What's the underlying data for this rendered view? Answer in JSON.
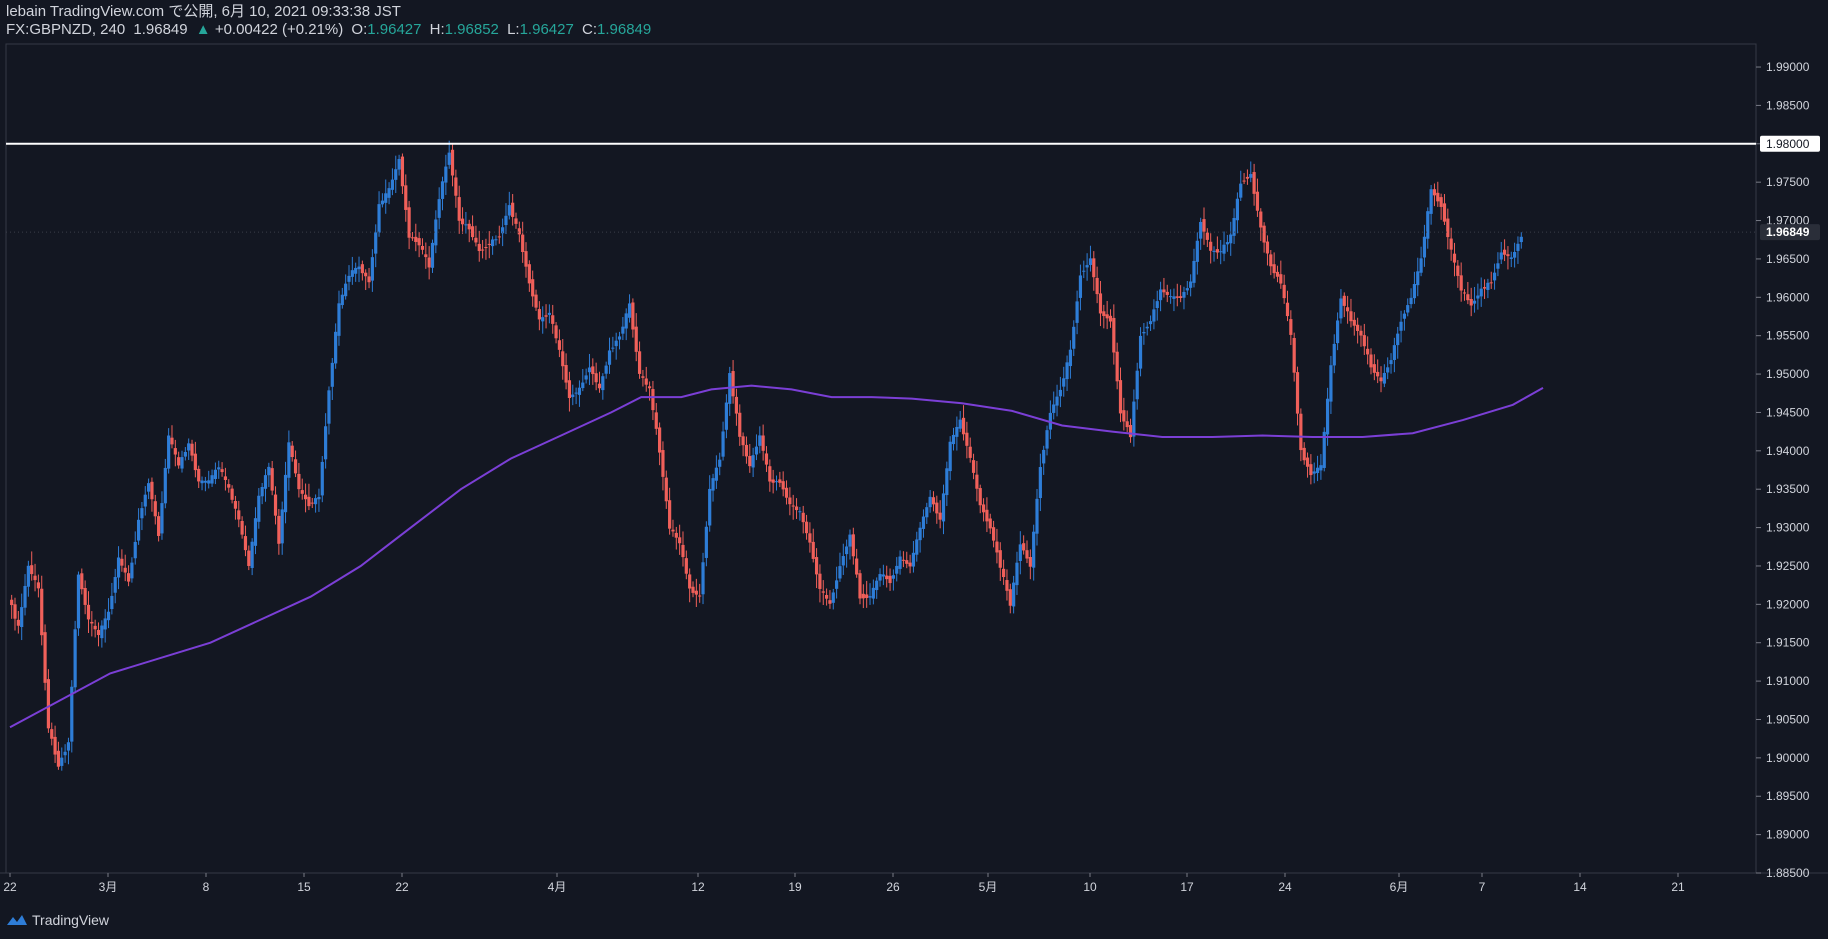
{
  "header": {
    "published": "lebain TradingView.com で公開, 6月 10, 2021 09:33:38 JST",
    "symbol": "FX:GBPNZD, 240",
    "last": "1.96849",
    "change_arrow": "▲",
    "change": "+0.00422 (+0.21%)",
    "o_label": "O:",
    "o_value": "1.96427",
    "h_label": "H:",
    "h_value": "1.96852",
    "l_label": "L:",
    "l_value": "1.96427",
    "c_label": "C:",
    "c_value": "1.96849"
  },
  "footer": {
    "brand": "TradingView"
  },
  "colors": {
    "background": "#131722",
    "up": "#2e7dd7",
    "down": "#f0605a",
    "ma": "#7b3fd6",
    "hline": "#ffffff",
    "grid": "#2a2e39"
  },
  "chart_data": {
    "type": "candlestick",
    "symbol": "FX:GBPNZD",
    "interval": "240",
    "y_axis": {
      "ylim": [
        1.885,
        1.993
      ],
      "ticks": [
        "1.99000",
        "1.98500",
        "1.98000",
        "1.97500",
        "1.97000",
        "1.96500",
        "1.96000",
        "1.95500",
        "1.95000",
        "1.94500",
        "1.94000",
        "1.93500",
        "1.93000",
        "1.92500",
        "1.92000",
        "1.91500",
        "1.91000",
        "1.90500",
        "1.90000",
        "1.89500",
        "1.89000",
        "1.88500"
      ]
    },
    "x_axis": {
      "labels": [
        "22",
        "3月",
        "8",
        "15",
        "22",
        "4月",
        "12",
        "19",
        "26",
        "5月",
        "10",
        "17",
        "24",
        "6月",
        "7",
        "14",
        "21"
      ]
    },
    "horizontal_line": {
      "value": 1.98,
      "label": "1.98000"
    },
    "last_price_label": "1.96849",
    "price_path": [
      [
        0,
        1.921
      ],
      [
        1,
        1.917
      ],
      [
        2,
        1.925
      ],
      [
        3,
        1.922
      ],
      [
        4,
        1.904
      ],
      [
        5,
        1.899
      ],
      [
        6,
        1.902
      ],
      [
        7,
        1.924
      ],
      [
        8,
        1.918
      ],
      [
        9,
        1.916
      ],
      [
        10,
        1.919
      ],
      [
        11,
        1.926
      ],
      [
        12,
        1.923
      ],
      [
        13,
        1.931
      ],
      [
        14,
        1.936
      ],
      [
        15,
        1.929
      ],
      [
        16,
        1.942
      ],
      [
        17,
        1.938
      ],
      [
        18,
        1.941
      ],
      [
        19,
        1.936
      ],
      [
        20,
        1.936
      ],
      [
        21,
        1.938
      ],
      [
        22,
        1.935
      ],
      [
        23,
        1.931
      ],
      [
        24,
        1.925
      ],
      [
        25,
        1.934
      ],
      [
        26,
        1.938
      ],
      [
        27,
        1.928
      ],
      [
        28,
        1.941
      ],
      [
        29,
        1.935
      ],
      [
        30,
        1.933
      ],
      [
        31,
        1.934
      ],
      [
        32,
        1.948
      ],
      [
        33,
        1.959
      ],
      [
        34,
        1.963
      ],
      [
        35,
        1.964
      ],
      [
        36,
        1.962
      ],
      [
        37,
        1.972
      ],
      [
        38,
        1.974
      ],
      [
        39,
        1.978
      ],
      [
        40,
        1.968
      ],
      [
        41,
        1.967
      ],
      [
        42,
        1.964
      ],
      [
        43,
        1.973
      ],
      [
        44,
        1.979
      ],
      [
        45,
        1.97
      ],
      [
        46,
        1.969
      ],
      [
        47,
        1.966
      ],
      [
        48,
        1.967
      ],
      [
        49,
        1.968
      ],
      [
        50,
        1.972
      ],
      [
        51,
        1.968
      ],
      [
        52,
        1.962
      ],
      [
        53,
        1.957
      ],
      [
        54,
        1.958
      ],
      [
        55,
        1.953
      ],
      [
        56,
        1.947
      ],
      [
        57,
        1.948
      ],
      [
        58,
        1.951
      ],
      [
        59,
        1.948
      ],
      [
        60,
        1.953
      ],
      [
        61,
        1.955
      ],
      [
        62,
        1.959
      ],
      [
        63,
        1.95
      ],
      [
        64,
        1.948
      ],
      [
        65,
        1.94
      ],
      [
        66,
        1.93
      ],
      [
        67,
        1.928
      ],
      [
        68,
        1.922
      ],
      [
        69,
        1.921
      ],
      [
        70,
        1.935
      ],
      [
        71,
        1.939
      ],
      [
        72,
        1.95
      ],
      [
        73,
        1.942
      ],
      [
        74,
        1.938
      ],
      [
        75,
        1.942
      ],
      [
        76,
        1.936
      ],
      [
        77,
        1.936
      ],
      [
        78,
        1.933
      ],
      [
        79,
        1.932
      ],
      [
        80,
        1.928
      ],
      [
        81,
        1.922
      ],
      [
        82,
        1.92
      ],
      [
        83,
        1.925
      ],
      [
        84,
        1.929
      ],
      [
        85,
        1.921
      ],
      [
        86,
        1.921
      ],
      [
        87,
        1.924
      ],
      [
        88,
        1.923
      ],
      [
        89,
        1.926
      ],
      [
        90,
        1.925
      ],
      [
        91,
        1.93
      ],
      [
        92,
        1.934
      ],
      [
        93,
        1.931
      ],
      [
        94,
        1.941
      ],
      [
        95,
        1.944
      ],
      [
        96,
        1.939
      ],
      [
        97,
        1.933
      ],
      [
        98,
        1.93
      ],
      [
        99,
        1.925
      ],
      [
        100,
        1.92
      ],
      [
        101,
        1.928
      ],
      [
        102,
        1.925
      ],
      [
        103,
        1.938
      ],
      [
        104,
        1.945
      ],
      [
        105,
        1.948
      ],
      [
        106,
        1.953
      ],
      [
        107,
        1.963
      ],
      [
        108,
        1.965
      ],
      [
        109,
        1.958
      ],
      [
        110,
        1.957
      ],
      [
        111,
        1.945
      ],
      [
        112,
        1.942
      ],
      [
        113,
        1.955
      ],
      [
        114,
        1.957
      ],
      [
        115,
        1.961
      ],
      [
        116,
        1.96
      ],
      [
        117,
        1.96
      ],
      [
        118,
        1.962
      ],
      [
        119,
        1.97
      ],
      [
        120,
        1.966
      ],
      [
        121,
        1.966
      ],
      [
        122,
        1.968
      ],
      [
        123,
        1.975
      ],
      [
        124,
        1.976
      ],
      [
        125,
        1.969
      ],
      [
        126,
        1.964
      ],
      [
        127,
        1.962
      ],
      [
        128,
        1.955
      ],
      [
        129,
        1.94
      ],
      [
        130,
        1.937
      ],
      [
        131,
        1.938
      ],
      [
        132,
        1.951
      ],
      [
        133,
        1.96
      ],
      [
        134,
        1.957
      ],
      [
        135,
        1.955
      ],
      [
        136,
        1.951
      ],
      [
        137,
        1.949
      ],
      [
        138,
        1.952
      ],
      [
        139,
        1.957
      ],
      [
        140,
        1.96
      ],
      [
        141,
        1.965
      ],
      [
        142,
        1.974
      ],
      [
        143,
        1.972
      ],
      [
        144,
        1.966
      ],
      [
        145,
        1.961
      ],
      [
        146,
        1.959
      ],
      [
        147,
        1.961
      ],
      [
        148,
        1.962
      ],
      [
        149,
        1.966
      ],
      [
        150,
        1.965
      ],
      [
        151,
        1.968
      ]
    ],
    "moving_average": [
      [
        0,
        1.904
      ],
      [
        10,
        1.911
      ],
      [
        20,
        1.915
      ],
      [
        30,
        1.921
      ],
      [
        35,
        1.925
      ],
      [
        40,
        1.93
      ],
      [
        45,
        1.935
      ],
      [
        50,
        1.939
      ],
      [
        55,
        1.942
      ],
      [
        60,
        1.945
      ],
      [
        63,
        1.947
      ],
      [
        67,
        1.947
      ],
      [
        70,
        1.948
      ],
      [
        74,
        1.9485
      ],
      [
        78,
        1.948
      ],
      [
        82,
        1.947
      ],
      [
        86,
        1.947
      ],
      [
        90,
        1.9468
      ],
      [
        95,
        1.9462
      ],
      [
        100,
        1.9452
      ],
      [
        105,
        1.9433
      ],
      [
        110,
        1.9425
      ],
      [
        115,
        1.9418
      ],
      [
        120,
        1.9418
      ],
      [
        125,
        1.942
      ],
      [
        130,
        1.9418
      ],
      [
        135,
        1.9418
      ],
      [
        140,
        1.9423
      ],
      [
        145,
        1.944
      ],
      [
        150,
        1.946
      ],
      [
        153,
        1.9482
      ]
    ]
  }
}
